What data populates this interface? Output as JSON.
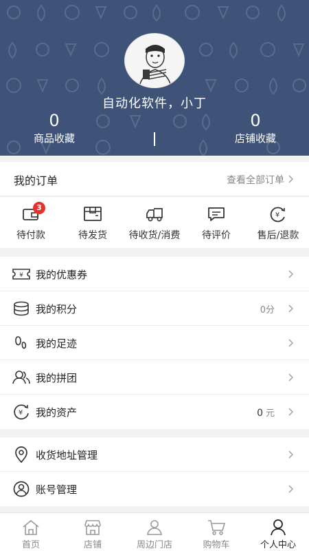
{
  "profile": {
    "nickname": "自动化软件，小丁",
    "favorites": [
      {
        "count": "0",
        "label": "商品收藏"
      },
      {
        "count": "0",
        "label": "店铺收藏"
      }
    ]
  },
  "orders": {
    "title": "我的订单",
    "view_all": "查看全部订单",
    "statuses": [
      {
        "label": "待付款",
        "icon": "wallet-icon",
        "badge": "3"
      },
      {
        "label": "待发货",
        "icon": "package-icon"
      },
      {
        "label": "待收货/消费",
        "icon": "delivery-truck-icon"
      },
      {
        "label": "待评价",
        "icon": "comment-icon"
      },
      {
        "label": "售后/退款",
        "icon": "refund-icon"
      }
    ]
  },
  "menu_group_1": [
    {
      "label": "我的优惠券",
      "icon": "coupon-icon"
    },
    {
      "label": "我的积分",
      "icon": "coins-stack-icon",
      "value": "0分"
    },
    {
      "label": "我的足迹",
      "icon": "footprint-icon"
    },
    {
      "label": "我的拼团",
      "icon": "group-users-icon"
    },
    {
      "label": "我的资产",
      "icon": "assets-icon",
      "value_number": "0",
      "value_unit": "元"
    }
  ],
  "menu_group_2": [
    {
      "label": "收货地址管理",
      "icon": "location-pin-icon"
    },
    {
      "label": "账号管理",
      "icon": "account-icon"
    }
  ],
  "tabbar": [
    {
      "label": "首页",
      "icon": "home-icon"
    },
    {
      "label": "店铺",
      "icon": "store-icon"
    },
    {
      "label": "周边门店",
      "icon": "nearby-stores-icon"
    },
    {
      "label": "购物车",
      "icon": "cart-icon"
    },
    {
      "label": "个人中心",
      "icon": "person-icon",
      "active": true
    }
  ],
  "colors": {
    "header": "#3f5379",
    "badge": "#e5322d",
    "background": "#f2f2f2"
  }
}
